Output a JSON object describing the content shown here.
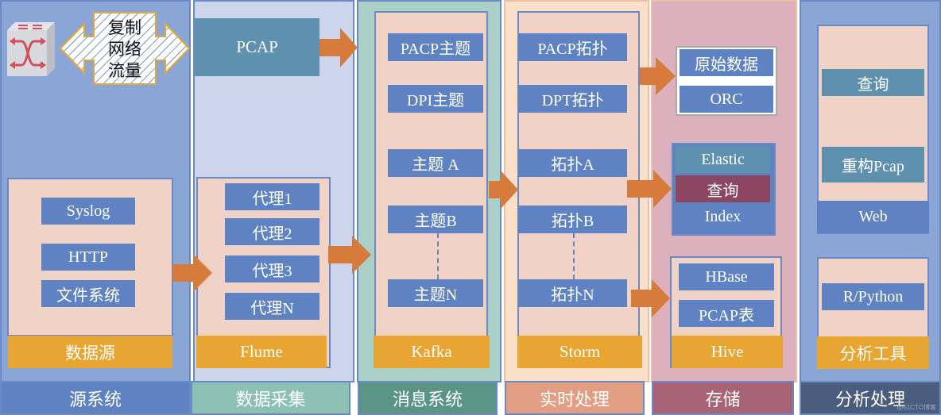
{
  "colors": {
    "source_bg": "#8aa6d6",
    "collect_bg": "#ccd5ec",
    "message_bg": "#abd0c8",
    "realtime_bg": "#fbe0c9",
    "storage_bg": "#dcb1bd",
    "analysis_bg": "#8aa6d6",
    "box_blue": "#5f83c2",
    "box_teal": "#5e90b0",
    "box_plum": "#8b4660",
    "gold": "#e8a532",
    "arrow": "#d77b3c",
    "panel": "#f0d2c6"
  },
  "source": {
    "switch_icon": "network-switch-icon",
    "mirror_label": "复制\n网络\n流量",
    "items": [
      "Syslog",
      "HTTP",
      "文件系统"
    ],
    "tool": "数据源",
    "footer": "源系统"
  },
  "collect": {
    "pcap": "PCAP",
    "items": [
      "代理1",
      "代理2",
      "代理3",
      "代理N"
    ],
    "tool": "Flume",
    "footer": "数据采集"
  },
  "message": {
    "items": [
      "PACP主题",
      "DPI主题",
      "主题 A",
      "主题B",
      "主题N"
    ],
    "tool": "Kafka",
    "footer": "消息系统"
  },
  "realtime": {
    "items": [
      "PACP拓扑",
      "DPT拓扑",
      "拓扑A",
      "拓扑B",
      "拓扑N"
    ],
    "tool": "Storm",
    "footer": "实时处理"
  },
  "storage": {
    "raw": [
      "原始数据",
      "ORC"
    ],
    "elastic": [
      "Elastic",
      "查询",
      "Index"
    ],
    "hive_items": [
      "HBase",
      "PCAP表"
    ],
    "tool": "Hive",
    "footer": "存储"
  },
  "analysis": {
    "web_items": [
      "查询",
      "重构Pcap"
    ],
    "web_label": "Web",
    "tools_items": [
      "R/Python"
    ],
    "tool": "分析工具",
    "footer": "分析处理"
  },
  "watermark": "@51CTO博客"
}
